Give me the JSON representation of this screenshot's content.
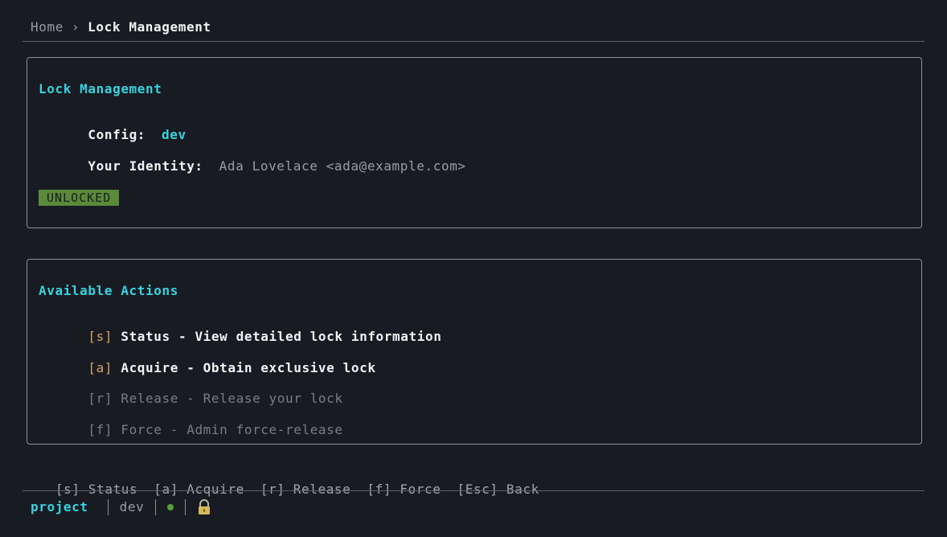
{
  "breadcrumb": {
    "home": "Home",
    "separator": "›",
    "current": "Lock Management"
  },
  "lock_panel": {
    "title": "Lock Management",
    "config_label": "Config:",
    "config_value": "dev",
    "identity_label": "Your Identity:",
    "identity_value": "Ada Lovelace <ada@example.com>",
    "status_badge": "UNLOCKED"
  },
  "actions_panel": {
    "title": "Available Actions",
    "actions": [
      {
        "key": "[s]",
        "text": "Status - View detailed lock information",
        "enabled": true
      },
      {
        "key": "[a]",
        "text": "Acquire - Obtain exclusive lock",
        "enabled": true
      },
      {
        "key": "[r]",
        "text": "Release - Release your lock",
        "enabled": false
      },
      {
        "key": "[f]",
        "text": "Force - Admin force-release",
        "enabled": false
      }
    ]
  },
  "shortcuts": [
    "[s] Status",
    "[a] Acquire",
    "[r] Release",
    "[f] Force",
    "[Esc] Back"
  ],
  "status_bar": {
    "project": "project",
    "config": "dev",
    "indicator_icon": "status-dot-icon",
    "lock_icon": "lock-icon"
  },
  "colors": {
    "accent": "#36d3de",
    "key_highlight": "#d9a064",
    "unlocked_badge": "#5a8a3a",
    "background": "#181b22"
  }
}
